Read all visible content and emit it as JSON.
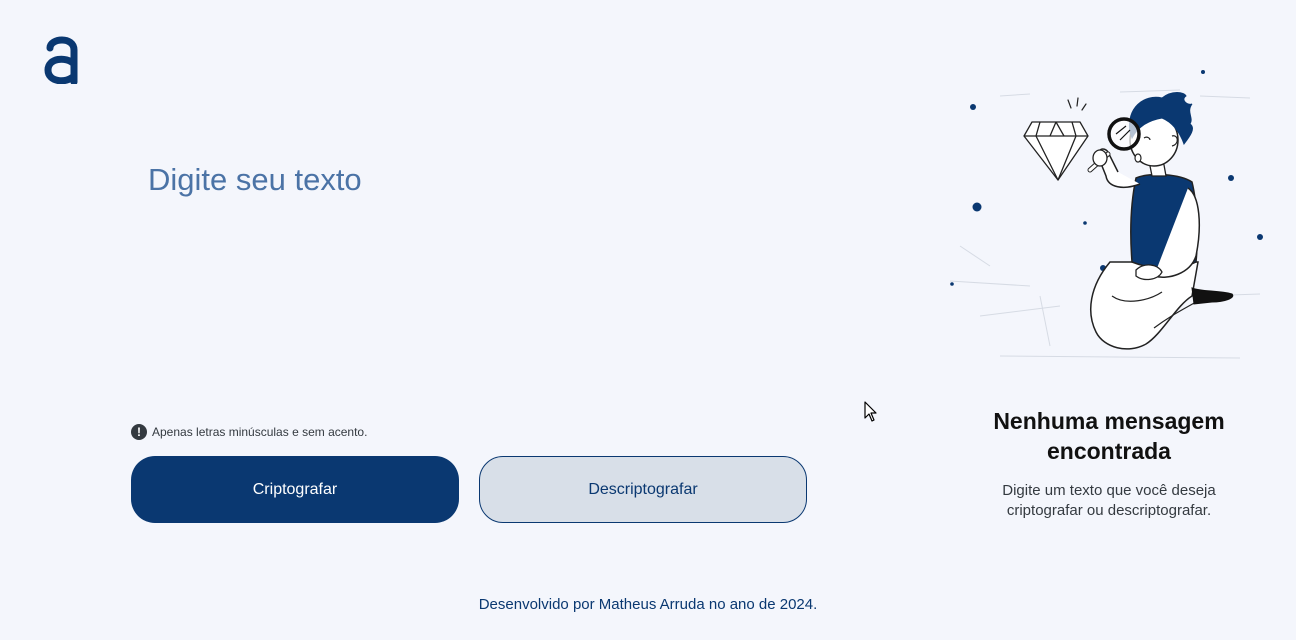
{
  "brand": {
    "logo_icon": "brand-a-logo",
    "accent_color": "#0a3871"
  },
  "input": {
    "placeholder": "Digite seu texto",
    "value": ""
  },
  "hint": {
    "icon": "exclamation-circle-icon",
    "text": "Apenas letras minúsculas e sem acento."
  },
  "buttons": {
    "encrypt_label": "Criptografar",
    "decrypt_label": "Descriptografar"
  },
  "output": {
    "title": "Nenhuma mensagem encontrada",
    "description": "Digite um texto que você deseja criptografar ou descriptografar.",
    "illustration": "person-with-magnifying-glass-illustration"
  },
  "footer": {
    "text": "Desenvolvido por Matheus Arruda no ano de 2024."
  }
}
